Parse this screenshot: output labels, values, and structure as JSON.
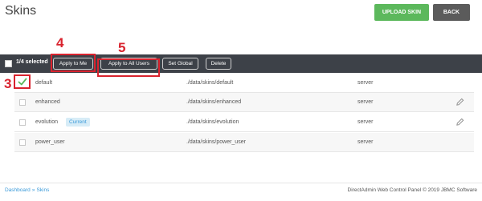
{
  "header": {
    "title": "Skins",
    "upload_label": "UPLOAD SKIN",
    "back_label": "BACK"
  },
  "toolbar": {
    "selected_text": "1/4 selected",
    "apply_me_label": "Apply to Me",
    "apply_all_label": "Apply to All Users",
    "set_global_label": "Set Global",
    "delete_label": "Delete"
  },
  "annotations": {
    "n3": "3",
    "n4": "4",
    "n5": "5"
  },
  "rows": [
    {
      "name": "default",
      "path": "./data/skins/default",
      "type": "server",
      "selected": true
    },
    {
      "name": "enhanced",
      "path": "./data/skins/enhanced",
      "type": "server"
    },
    {
      "name": "evolution",
      "badge": "Current",
      "path": "./data/skins/evolution",
      "type": "server"
    },
    {
      "name": "power_user",
      "path": "./data/skins/power_user",
      "type": "server"
    }
  ],
  "footer": {
    "crumb_home": "Dashboard",
    "crumb_sep": "»",
    "crumb_current": "Skins",
    "copyright": "DirectAdmin Web Control Panel © 2019 JBMC Software"
  },
  "colors": {
    "upload": "#5cb85c",
    "back": "#5b5b5b",
    "toolbar": "#3d4148",
    "annotation": "#d9232e",
    "badge_bg": "#d7ecf7",
    "link": "#3a9ad9"
  }
}
